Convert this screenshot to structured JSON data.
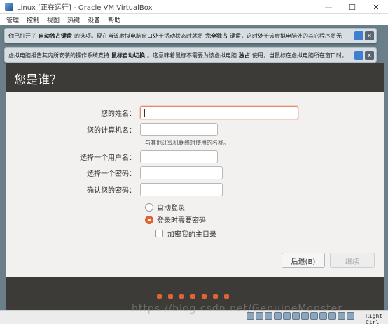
{
  "window": {
    "title": "Linux [正在运行] - Oracle VM VirtualBox",
    "controls": {
      "minimize": "—",
      "maximize": "☐",
      "close": "✕"
    }
  },
  "menu": [
    "管理",
    "控制",
    "视图",
    "热键",
    "设备",
    "帮助"
  ],
  "notices": [
    {
      "pre": "你已打开了",
      "bold1": "自动独占键盘",
      "mid": "的选项。现在当该虚拟电脑窗口处于活动状态时就将",
      "bold2": "完全独占",
      "post": "键盘，这时处于该虚拟电脑外的其它程序将无"
    },
    {
      "pre": "虚拟电脑报告其内所安装的操作系统支持",
      "bold1": "鼠标自动切换",
      "mid": "。这意味着鼠标不需要为该虚拟电脑",
      "bold2": "独占",
      "post": "使用，当鼠标在虚拟电脑所在窗口时，"
    }
  ],
  "installer": {
    "heading": "您是谁？",
    "fields": {
      "name_label": "您的姓名：",
      "computer_label": "您的计算机名：",
      "computer_hint": "与其他计算机联络时使用的名称。",
      "username_label": "选择一个用户名：",
      "password_label": "选择一个密码：",
      "confirm_label": "确认您的密码："
    },
    "options": {
      "auto_login": "自动登录",
      "require_password": "登录时需要密码",
      "encrypt_home": "加密我的主目录"
    },
    "buttons": {
      "back": "后退(B)",
      "continue": "继续"
    },
    "progress_dots": 7
  },
  "status": {
    "host_key": "Right Ctrl",
    "watermark": "https://blog.csdn.net/GenuineMonster"
  },
  "colors": {
    "accent": "#e16433",
    "dark_panel": "#3c3b37"
  }
}
